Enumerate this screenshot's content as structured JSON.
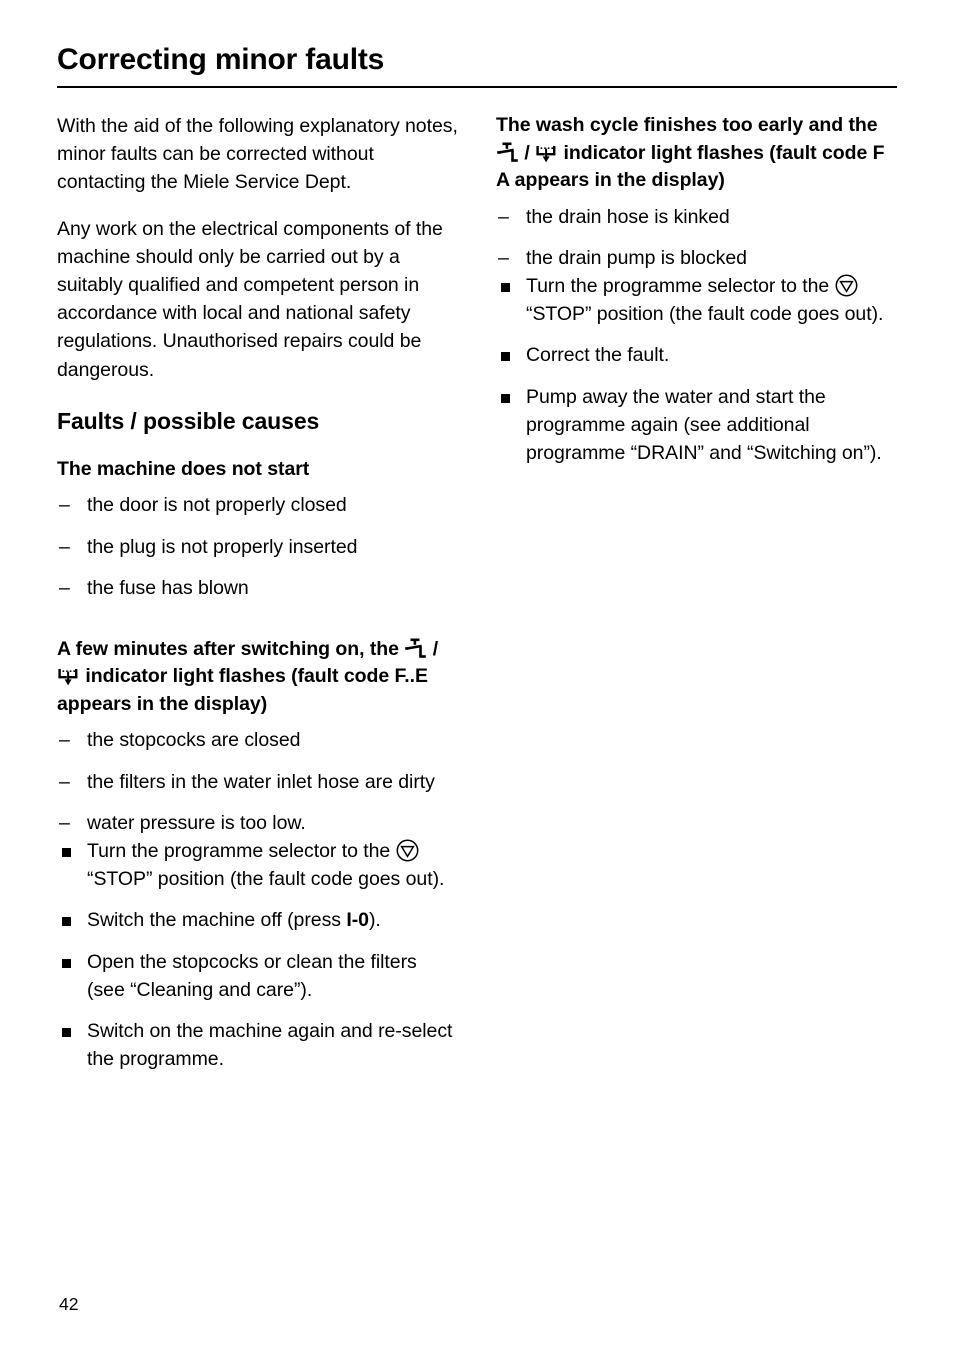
{
  "document": {
    "title": "Correcting minor faults",
    "page_number": "42"
  },
  "left_column": {
    "intro_paragraph_1": "With the aid of the following explanatory notes, minor faults can be corrected without contacting the Miele Service Dept.",
    "intro_paragraph_2": "Any work on the electrical components of the machine should only be carried out by a suitably qualified and competent person in accordance with local and national safety regulations. Unauthorised repairs could be dangerous.",
    "section_heading": "Faults / possible causes",
    "fault_1": {
      "heading": "The machine does not start",
      "causes": [
        "the door is not properly closed",
        "the plug is not properly inserted",
        "the fuse has blown"
      ]
    },
    "fault_2": {
      "heading_part_1": "A few minutes after switching on, the",
      "heading_icon_1": "tap-icon",
      "heading_separator": "/",
      "heading_icon_2": "drain-icon",
      "heading_part_2": "indicator light flashes (fault code F..E appears in the display)",
      "causes": [
        "the stopcocks are closed",
        "the filters in the water inlet hose are dirty",
        "water pressure is too low."
      ],
      "steps": [
        {
          "text_before_icon": "Turn the programme selector to the",
          "icon": "stop-triangle-icon",
          "text_after_icon": "“STOP” position (the fault code goes out)."
        },
        {
          "text_before_bold": "Switch the machine off (press ",
          "bold": "I-0",
          "text_after_bold": ")."
        },
        {
          "text": "Open the stopcocks or clean the filters (see “Cleaning and care”)."
        },
        {
          "text": "Switch on the machine again and re-select the programme."
        }
      ]
    }
  },
  "right_column": {
    "fault_3": {
      "heading_part_1": "The wash cycle finishes too early and the",
      "heading_icon_1": "tap-icon",
      "heading_separator": "/",
      "heading_icon_2": "drain-icon",
      "heading_part_2": "indicator light flashes (fault code F A appears in the display)",
      "causes": [
        "the drain hose is kinked",
        "the drain pump is blocked"
      ],
      "steps": [
        {
          "text_before_icon": "Turn the programme selector to the",
          "icon": "stop-triangle-icon",
          "text_after_icon": "“STOP” position (the fault code goes out)."
        },
        {
          "text": "Correct the fault."
        },
        {
          "text": "Pump away the water and start the programme again (see additional programme “DRAIN” and “Switching on”)."
        }
      ]
    }
  },
  "markers": {
    "dash": "–"
  },
  "colors": {
    "text": "#000000",
    "background": "#ffffff",
    "rule": "#000000"
  }
}
